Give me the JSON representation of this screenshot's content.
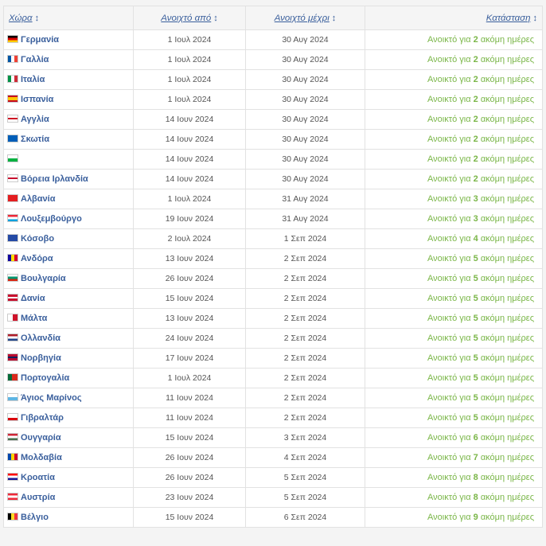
{
  "headers": {
    "country": "Χώρα",
    "open_from": "Ανοιχτό από",
    "open_until": "Ανοιχτό μέχρι",
    "status": "Κατάσταση",
    "sort_icon": "↕"
  },
  "status_prefix": "Ανοικτό για",
  "status_suffix": "ακόμη ημέρες",
  "rows": [
    {
      "country": "Γερμανία",
      "from": "1 Ιουλ 2024",
      "until": "30 Αυγ 2024",
      "days": "2",
      "flag": "linear-gradient(#000 33%,#d00 33% 66%,#fc0 66%)"
    },
    {
      "country": "Γαλλία",
      "from": "1 Ιουλ 2024",
      "until": "30 Αυγ 2024",
      "days": "2",
      "flag": "linear-gradient(90deg,#0055a4 33%,#fff 33% 66%,#ef4135 66%)"
    },
    {
      "country": "Ιταλία",
      "from": "1 Ιουλ 2024",
      "until": "30 Αυγ 2024",
      "days": "2",
      "flag": "linear-gradient(90deg,#009246 33%,#fff 33% 66%,#ce2b37 66%)"
    },
    {
      "country": "Ισπανία",
      "from": "1 Ιουλ 2024",
      "until": "30 Αυγ 2024",
      "days": "2",
      "flag": "linear-gradient(#c60b1e 25%,#ffc400 25% 75%,#c60b1e 75%)"
    },
    {
      "country": "Αγγλία",
      "from": "14 Ιουν 2024",
      "until": "30 Αυγ 2024",
      "days": "2",
      "flag": "linear-gradient(#fff 40%,#ce1124 40% 60%,#fff 60%)"
    },
    {
      "country": "Σκωτία",
      "from": "14 Ιουν 2024",
      "until": "30 Αυγ 2024",
      "days": "2",
      "flag": "linear-gradient(#005eb8,#005eb8)"
    },
    {
      "country": "",
      "from": "14 Ιουν 2024",
      "until": "30 Αυγ 2024",
      "days": "2",
      "flag": "linear-gradient(#fff 50%,#00b140 50%)"
    },
    {
      "country": "Βόρεια Ιρλανδία",
      "from": "14 Ιουν 2024",
      "until": "30 Αυγ 2024",
      "days": "2",
      "flag": "linear-gradient(#fff 40%,#c8102e 40% 60%,#fff 60%)"
    },
    {
      "country": "Αλβανία",
      "from": "1 Ιουλ 2024",
      "until": "31 Αυγ 2024",
      "days": "3",
      "flag": "linear-gradient(#e41e20,#e41e20)"
    },
    {
      "country": "Λουξεμβούργο",
      "from": "19 Ιουν 2024",
      "until": "31 Αυγ 2024",
      "days": "3",
      "flag": "linear-gradient(#ed2939 33%,#fff 33% 66%,#00a1de 66%)"
    },
    {
      "country": "Κόσοβο",
      "from": "2 Ιουλ 2024",
      "until": "1 Σεπ 2024",
      "days": "4",
      "flag": "linear-gradient(#244aa5,#244aa5)"
    },
    {
      "country": "Ανδόρα",
      "from": "13 Ιουν 2024",
      "until": "2 Σεπ 2024",
      "days": "5",
      "flag": "linear-gradient(90deg,#10069f 33%,#fedd00 33% 66%,#d50032 66%)"
    },
    {
      "country": "Βουλγαρία",
      "from": "26 Ιουν 2024",
      "until": "2 Σεπ 2024",
      "days": "5",
      "flag": "linear-gradient(#fff 33%,#00966e 33% 66%,#d62612 66%)"
    },
    {
      "country": "Δανία",
      "from": "15 Ιουν 2024",
      "until": "2 Σεπ 2024",
      "days": "5",
      "flag": "linear-gradient(#c8102e 40%,#fff 40% 60%,#c8102e 60%)"
    },
    {
      "country": "Μάλτα",
      "from": "13 Ιουν 2024",
      "until": "2 Σεπ 2024",
      "days": "5",
      "flag": "linear-gradient(90deg,#fff 50%,#cf142b 50%)"
    },
    {
      "country": "Ολλανδία",
      "from": "24 Ιουν 2024",
      "until": "2 Σεπ 2024",
      "days": "5",
      "flag": "linear-gradient(#ae1c28 33%,#fff 33% 66%,#21468b 66%)"
    },
    {
      "country": "Νορβηγία",
      "from": "17 Ιουν 2024",
      "until": "2 Σεπ 2024",
      "days": "5",
      "flag": "linear-gradient(#ba0c2f 35%,#00205b 35% 65%,#ba0c2f 65%)"
    },
    {
      "country": "Πορτογαλία",
      "from": "1 Ιουλ 2024",
      "until": "2 Σεπ 2024",
      "days": "5",
      "flag": "linear-gradient(90deg,#046a38 40%,#da291c 40%)"
    },
    {
      "country": "Άγιος Μαρίνος",
      "from": "11 Ιουν 2024",
      "until": "2 Σεπ 2024",
      "days": "5",
      "flag": "linear-gradient(#fff 50%,#5eb6e4 50%)"
    },
    {
      "country": "Γιβραλτάρ",
      "from": "11 Ιουν 2024",
      "until": "2 Σεπ 2024",
      "days": "5",
      "flag": "linear-gradient(#fff 65%,#da000c 65%)"
    },
    {
      "country": "Ουγγαρία",
      "from": "15 Ιουν 2024",
      "until": "3 Σεπ 2024",
      "days": "6",
      "flag": "linear-gradient(#ce2939 33%,#fff 33% 66%,#477050 66%)"
    },
    {
      "country": "Μολδαβία",
      "from": "26 Ιουν 2024",
      "until": "4 Σεπ 2024",
      "days": "7",
      "flag": "linear-gradient(90deg,#0046ae 33%,#ffd200 33% 66%,#cc092f 66%)"
    },
    {
      "country": "Κροατία",
      "from": "26 Ιουν 2024",
      "until": "5 Σεπ 2024",
      "days": "8",
      "flag": "linear-gradient(#ff0000 33%,#fff 33% 66%,#171796 66%)"
    },
    {
      "country": "Αυστρία",
      "from": "23 Ιουν 2024",
      "until": "5 Σεπ 2024",
      "days": "8",
      "flag": "linear-gradient(#ed2939 33%,#fff 33% 66%,#ed2939 66%)"
    },
    {
      "country": "Βέλγιο",
      "from": "15 Ιουν 2024",
      "until": "6 Σεπ 2024",
      "days": "9",
      "flag": "linear-gradient(90deg,#000 33%,#fdda24 33% 66%,#ef3340 66%)"
    }
  ]
}
